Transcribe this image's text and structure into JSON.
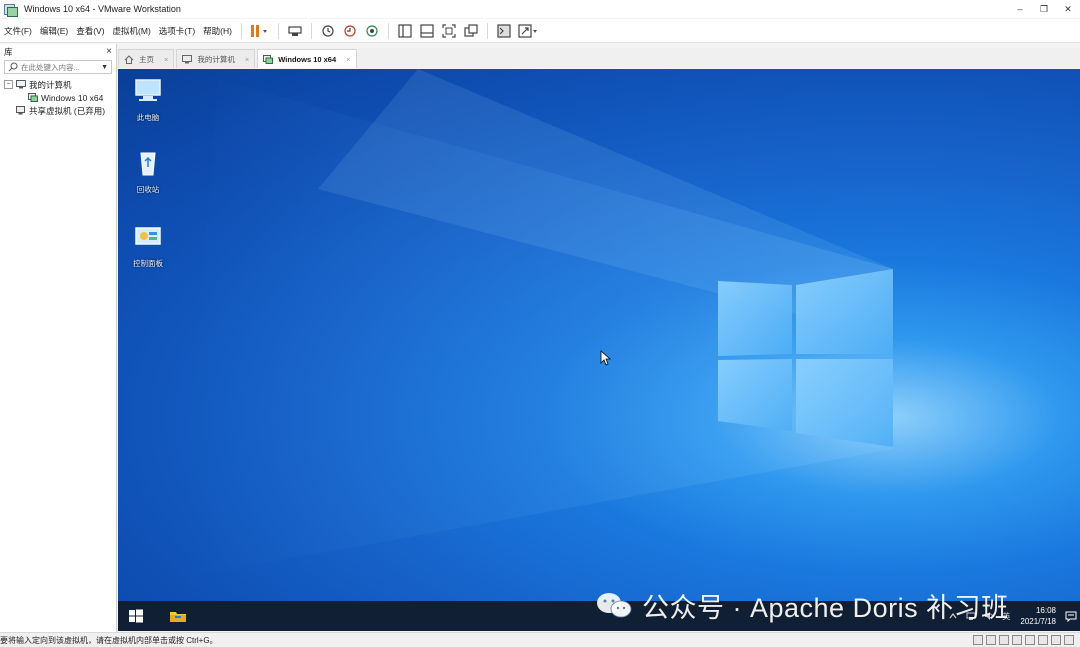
{
  "window": {
    "title": "Windows 10 x64 - VMware Workstation",
    "controls": [
      "–",
      "❐",
      "✕"
    ]
  },
  "menu": {
    "items": [
      "文件(F)",
      "编辑(E)",
      "查看(V)",
      "虚拟机(M)",
      "选项卡(T)",
      "帮助(H)"
    ]
  },
  "toolbar": {
    "icons": [
      "pause-icon",
      "send-ctrl-alt-del-icon",
      "snapshot-icon",
      "revert-snapshot-icon",
      "manage-snapshots-icon",
      "show-library-icon",
      "thumbnail-bar-icon",
      "fullscreen-icon",
      "unity-icon",
      "console-view-icon",
      "stretch-guest-icon"
    ],
    "accent": "#e07a1f"
  },
  "library": {
    "title": "库",
    "close": "×",
    "search_placeholder": "在此处键入内容...",
    "tree": {
      "root": "我的计算机",
      "vm": "Windows 10 x64",
      "shared": "共享虚拟机 (已弃用)"
    }
  },
  "tabs": [
    {
      "label": "主页",
      "icon": "home-icon",
      "active": false
    },
    {
      "label": "我的计算机",
      "icon": "computer-icon",
      "active": false
    },
    {
      "label": "Windows 10 x64",
      "icon": "vm-icon",
      "active": true
    }
  ],
  "desktop": {
    "icons": [
      {
        "label": "此电脑",
        "icon": "this-pc-icon"
      },
      {
        "label": "回收站",
        "icon": "recycle-bin-icon"
      },
      {
        "label": "控制面板",
        "icon": "control-panel-icon"
      }
    ],
    "colors": {
      "background": "#1765cc",
      "taskbar": "#101f33"
    }
  },
  "taskbar": {
    "lang": "英",
    "time": "16:08",
    "date": "2021/7/18"
  },
  "watermark": {
    "text": "公众号 · Apache Doris 补习班"
  },
  "status": {
    "text": "要将输入定向到该虚拟机，请在虚拟机内部单击或按 Ctrl+G。"
  }
}
